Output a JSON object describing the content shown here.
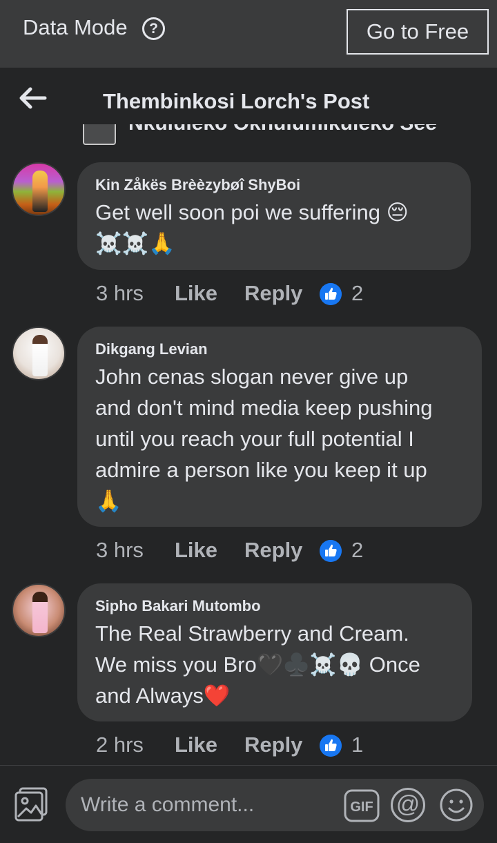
{
  "data_mode_bar": {
    "label": "Data Mode",
    "help_icon": "?",
    "go_free_label": "Go to Free"
  },
  "header": {
    "back_icon": "arrow-left-icon",
    "title": "Thembinkosi Lorch's Post"
  },
  "cutoff_comment": {
    "text": "Nkululeko Okhulumikuleko See"
  },
  "comments": [
    {
      "author": "Kin Zåkës Brèèzybøî ShyBoi",
      "text_lines": [
        "Get well soon poi  we suffering 😔",
        "☠️☠️🙏"
      ],
      "time": "3 hrs",
      "like_label": "Like",
      "reply_label": "Reply",
      "like_count": "2"
    },
    {
      "author": "Dikgang Levian",
      "text_lines": [
        "John cenas slogan never give up",
        "and don't mind media keep pushing",
        "until you reach your full potential I",
        "admire a person like you keep it up",
        "🙏"
      ],
      "time": "3 hrs",
      "like_label": "Like",
      "reply_label": "Reply",
      "like_count": "2"
    },
    {
      "author": "Sipho Bakari Mutombo",
      "text_lines": [
        "The Real Strawberry and Cream.",
        "We miss you Bro🖤♣️☠️💀 Once",
        "and Always❤️"
      ],
      "time": "2 hrs",
      "like_label": "Like",
      "reply_label": "Reply",
      "like_count": "1"
    }
  ],
  "composer": {
    "placeholder": "Write a comment...",
    "gif_label": "GIF",
    "at_symbol": "@"
  },
  "colors": {
    "background": "#242526",
    "bubble": "#3a3b3c",
    "text": "#e4e6eb",
    "secondary_text": "#b0b3b8",
    "like_blue": "#1877f2"
  }
}
